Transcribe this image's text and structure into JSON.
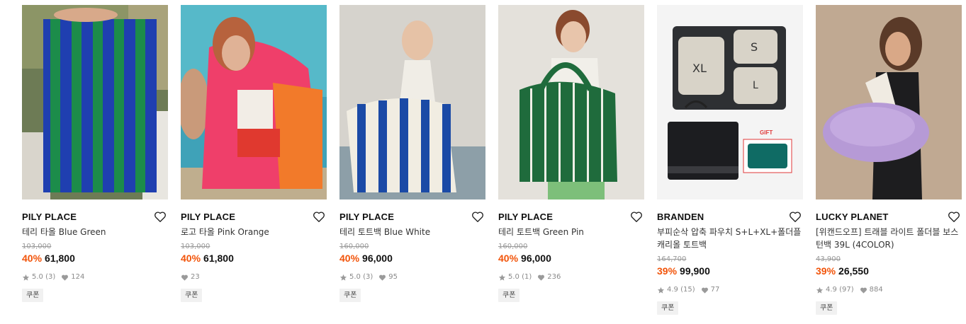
{
  "coupon_label": "쿠폰",
  "products": [
    {
      "brand": "PILY PLACE",
      "title": "테리 타올 Blue Green",
      "original_price": "103,000",
      "discount": "40%",
      "price": "61,800",
      "rating": "5.0",
      "reviews": "(3)",
      "likes": "124"
    },
    {
      "brand": "PILY PLACE",
      "title": "로고 타올 Pink Orange",
      "original_price": "103,000",
      "discount": "40%",
      "price": "61,800",
      "likes": "23"
    },
    {
      "brand": "PILY PLACE",
      "title": "테리 토트백 Blue White",
      "original_price": "160,000",
      "discount": "40%",
      "price": "96,000",
      "rating": "5.0",
      "reviews": "(3)",
      "likes": "95"
    },
    {
      "brand": "PILY PLACE",
      "title": "테리 토트백 Green Pin",
      "original_price": "160,000",
      "discount": "40%",
      "price": "96,000",
      "rating": "5.0",
      "reviews": "(1)",
      "likes": "236"
    },
    {
      "brand": "BRANDEN",
      "title": "부피순삭 압축 파우치 S+L+XL+폴더플 캐리올 토트백",
      "original_price": "164,700",
      "discount": "39%",
      "price": "99,900",
      "rating": "4.9",
      "reviews": "(15)",
      "likes": "77",
      "image_text": {
        "xl": "XL",
        "s": "S",
        "l": "L",
        "gift": "GIFT"
      }
    },
    {
      "brand": "LUCKY PLANET",
      "title": "[위캔드오프] 트래블 라이트 폴더블 보스턴백 39L (4COLOR)",
      "original_price": "43,900",
      "discount": "39%",
      "price": "26,550",
      "rating": "4.9",
      "reviews": "(97)",
      "likes": "884"
    }
  ],
  "colors": {
    "discount": "#f2540a",
    "brand_text": "#111111",
    "meta_text": "#8a8a8a"
  }
}
